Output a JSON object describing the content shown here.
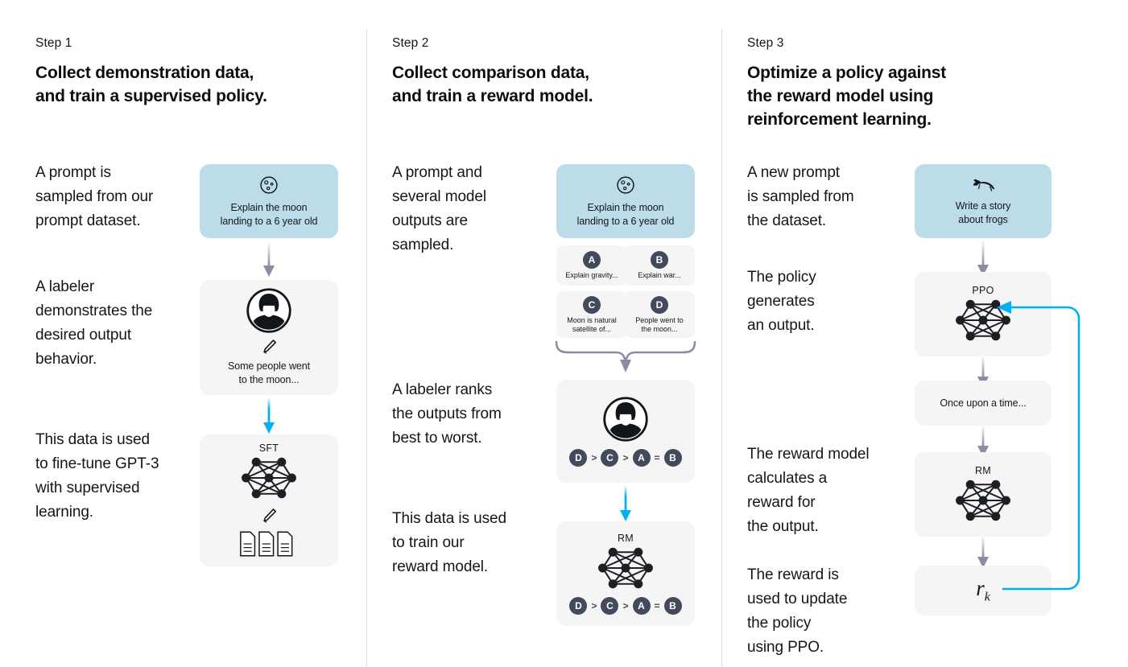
{
  "meta": {
    "colors": {
      "prompt_box": "#bcdcea",
      "neutral_box": "#f4f5f4",
      "gray_arrow": "#8c8ca4",
      "blue_arrow": "#00b0f0",
      "badge": "#434a5c",
      "divider": "#d9dde1",
      "text": "#11161a"
    }
  },
  "columns": [
    {
      "step_label": "Step 1",
      "step_title": "Collect demonstration data,\nand train a supervised policy.",
      "paragraphs": [
        "A prompt is\nsampled from our\nprompt dataset.",
        "A labeler\ndemonstrates the\ndesired output\nbehavior.",
        "This data is used\nto fine-tune GPT-3\nwith supervised\nlearning."
      ],
      "nodes": {
        "prompt_text": "Explain the moon\nlanding to a 6 year old",
        "demo_text": "Some people went\nto the moon...",
        "model_title": "SFT"
      }
    },
    {
      "step_label": "Step 2",
      "step_title": "Collect comparison data,\nand train a reward model.",
      "paragraphs": [
        "A prompt and\nseveral model\noutputs are\nsampled.",
        "A labeler ranks\nthe outputs from\nbest to worst.",
        "This data is used\nto train our\nreward model."
      ],
      "nodes": {
        "prompt_text": "Explain the moon\nlanding to a 6 year old",
        "outputs": [
          {
            "letter": "A",
            "text": "Explain gravity..."
          },
          {
            "letter": "B",
            "text": "Explain war..."
          },
          {
            "letter": "C",
            "text": "Moon is natural\nsatellite of..."
          },
          {
            "letter": "D",
            "text": "People went to\nthe moon..."
          }
        ],
        "ranking": [
          "D",
          ">",
          "C",
          ">",
          "A",
          "=",
          "B"
        ],
        "model_title": "RM"
      }
    },
    {
      "step_label": "Step 3",
      "step_title": "Optimize a policy against\nthe reward model using\nreinforcement learning.",
      "paragraphs": [
        "A new prompt\nis sampled from\nthe dataset.",
        "The policy\ngenerates\nan output.",
        "The reward model\ncalculates a\nreward for\nthe output.",
        "The reward is\nused to update\nthe policy\nusing PPO."
      ],
      "nodes": {
        "prompt_text": "Write a story\nabout frogs",
        "policy_title": "PPO",
        "output_text": "Once upon a time...",
        "reward_model_title": "RM",
        "reward_symbol": "r",
        "reward_subscript": "k"
      }
    }
  ]
}
